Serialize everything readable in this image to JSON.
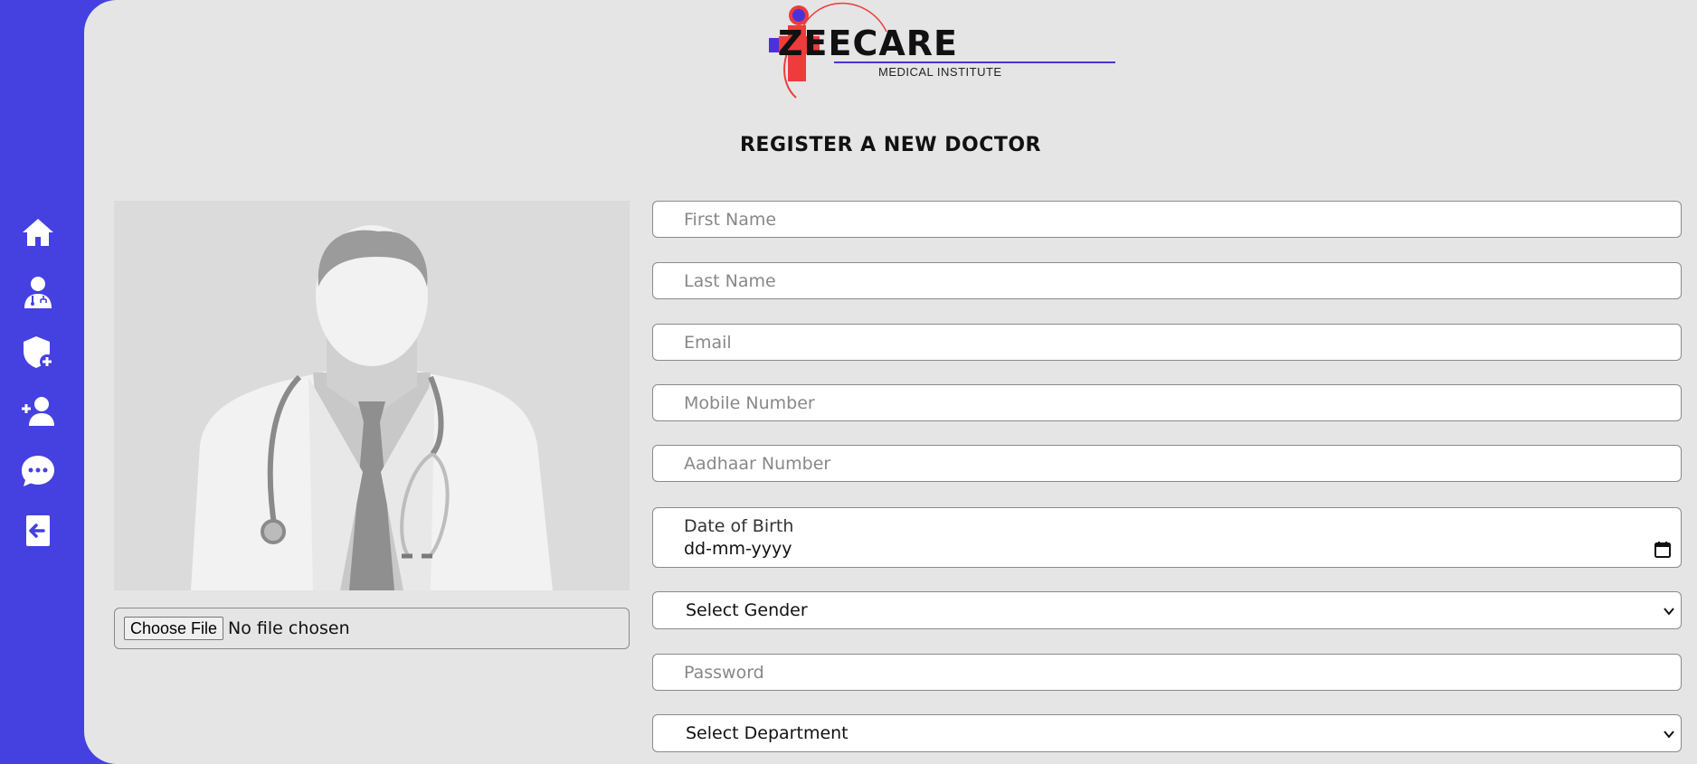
{
  "brand": {
    "name": "ZEECARE",
    "subtitle": "MEDICAL INSTITUTE"
  },
  "page": {
    "title": "REGISTER A NEW DOCTOR"
  },
  "sidebar": {
    "items": [
      {
        "icon": "home-icon"
      },
      {
        "icon": "doctor-icon"
      },
      {
        "icon": "add-admin-icon"
      },
      {
        "icon": "add-doctor-icon"
      },
      {
        "icon": "messages-icon"
      },
      {
        "icon": "logout-icon"
      }
    ]
  },
  "upload": {
    "button_label": "Choose File",
    "status": "No file chosen"
  },
  "form": {
    "first_name": {
      "placeholder": "First Name",
      "value": ""
    },
    "last_name": {
      "placeholder": "Last Name",
      "value": ""
    },
    "email": {
      "placeholder": "Email",
      "value": ""
    },
    "mobile": {
      "placeholder": "Mobile Number",
      "value": ""
    },
    "aadhaar": {
      "placeholder": "Aadhaar Number",
      "value": ""
    },
    "dob": {
      "label": "Date of Birth",
      "value": "dd-mm-yyyy"
    },
    "gender": {
      "selected": "Select Gender"
    },
    "password": {
      "placeholder": "Password",
      "value": ""
    },
    "department": {
      "selected": "Select Department"
    }
  },
  "colors": {
    "sidebar_bg": "#4540e0",
    "main_bg": "#e5e5e5",
    "brand_red": "#ee3b3b",
    "brand_blue": "#4b32d8"
  }
}
